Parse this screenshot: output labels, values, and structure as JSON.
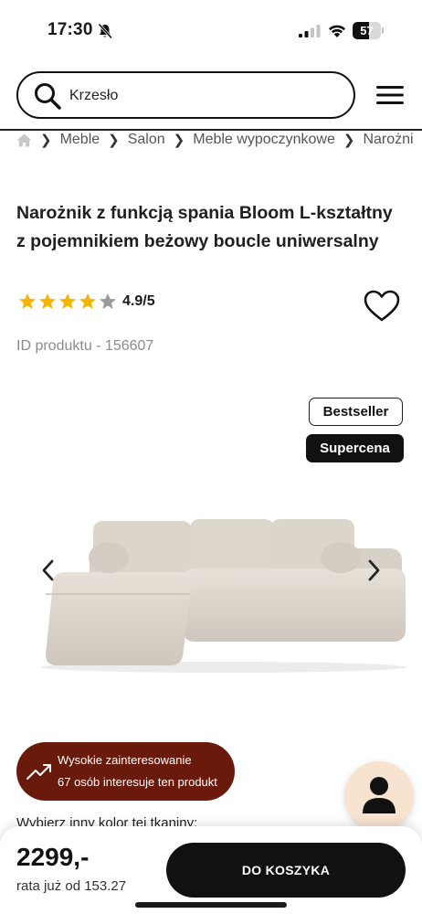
{
  "status_bar": {
    "time": "17:30",
    "battery_level": "57",
    "icons": [
      "bell-slash-icon",
      "signal-icon",
      "wifi-icon",
      "battery-icon"
    ]
  },
  "search": {
    "value": "Krzesło",
    "icon": "search-icon"
  },
  "menu_icon": "hamburger-menu-icon",
  "breadcrumb": {
    "home_icon": "home-icon",
    "items": [
      "Meble",
      "Salon",
      "Meble wypoczynkowe",
      "Narożni"
    ]
  },
  "product": {
    "title": "Narożnik z funkcją spania Bloom L-kształtny z pojemnikiem beżowy boucle uniwersalny",
    "rating_text": "4.9/5",
    "stars_filled": 4,
    "stars_total": 5,
    "id_label": "ID produktu - 156607"
  },
  "badges": {
    "bestseller": "Bestseller",
    "supercena": "Supercena"
  },
  "interest": {
    "line1": "Wysokie zainteresowanie",
    "line2": "67 osób interesuje ten produkt"
  },
  "color_picker_label": "Wybierz inny kolor tej tkaniny:",
  "purchase": {
    "price": "2299,-",
    "installment": "rata już od 153.27",
    "cart_button": "DO KOSZYKA"
  },
  "colors": {
    "interest_bg": "#6a1a0b",
    "star": "#f5b400",
    "star_empty": "#9a9a9a",
    "avatar_bg": "#f7e3cf",
    "sofa": "#ddd6cd"
  }
}
